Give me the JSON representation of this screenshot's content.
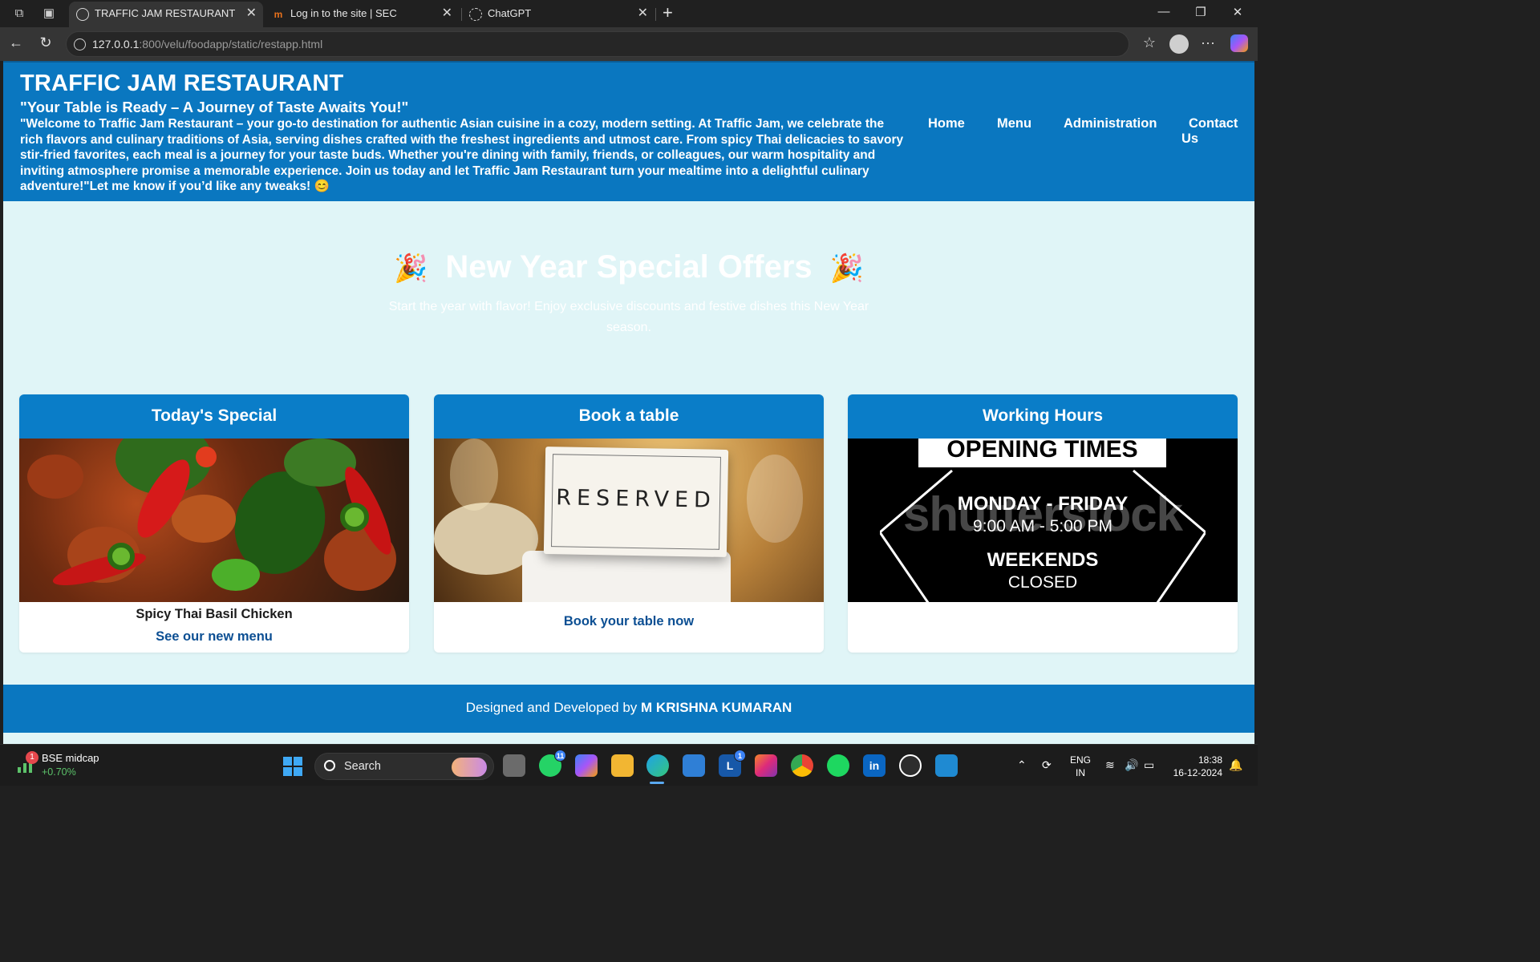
{
  "browser": {
    "tabs": [
      {
        "label": "TRAFFIC JAM RESTAURANT",
        "active": true
      },
      {
        "label": "Log in to the site | SEC",
        "active": false
      },
      {
        "label": "ChatGPT",
        "active": false
      }
    ],
    "address": {
      "host": "127.0.0.1",
      "rest": ":800/velu/foodapp/static/restapp.html"
    }
  },
  "header": {
    "title": "TRAFFIC JAM RESTAURANT",
    "tagline": "\"Your Table is Ready – A Journey of Taste Awaits You!\"",
    "intro": "\"Welcome to Traffic Jam Restaurant – your go-to destination for authentic Asian cuisine in a cozy, modern setting. At Traffic Jam, we celebrate the rich flavors and culinary traditions of Asia, serving dishes crafted with the freshest ingredients and utmost care. From spicy Thai delicacies to savory stir-fried favorites, each meal is a journey for your taste buds. Whether you're dining with family, friends, or colleagues, our warm hospitality and inviting atmosphere promise a memorable experience. Join us today and let Traffic Jam Restaurant turn your mealtime into a delightful culinary adventure!\"Let me know if you’d like any tweaks! 😊",
    "nav": [
      {
        "label": "Home"
      },
      {
        "label": "Menu"
      },
      {
        "label": "Administration"
      },
      {
        "label": "Contact Us"
      }
    ]
  },
  "hero": {
    "icon": "🎉",
    "title": "New Year Special Offers",
    "subtitle": "Start the year with flavor! Enjoy exclusive discounts and festive dishes this New Year season."
  },
  "cards": [
    {
      "title": "Today's Special",
      "caption": "Spicy Thai Basil Chicken",
      "link": "See our new menu",
      "image": "spicy-thai-basil-chicken-photo"
    },
    {
      "title": "Book a table",
      "link": "Book your table now",
      "image": "reserved-table-photo",
      "image_text": "RESERVED"
    },
    {
      "title": "Working Hours",
      "image": "opening-times-sign",
      "image_text": {
        "banner": "OPENING TIMES",
        "weekday_label": "MONDAY - FRIDAY",
        "weekday_hours": "9:00 AM - 5:00 PM",
        "weekend_label": "WEEKENDS",
        "weekend_status": "CLOSED",
        "watermark": "shutterstock"
      }
    }
  ],
  "footer": {
    "prefix": "Designed and Developed by",
    "author": "M KRISHNA KUMARAN"
  },
  "taskbar": {
    "widget_badge": "1",
    "widget_title": "BSE midcap",
    "widget_change": "+0.70%",
    "search_label": "Search",
    "whatsapp_badge": "11",
    "linkedin_learning_badge": "1",
    "language_line1": "ENG",
    "language_line2": "IN",
    "time": "18:38",
    "date": "16-12-2024"
  },
  "colors": {
    "header_blue": "#0a77c0",
    "page_bg": "#e0f5f7",
    "card_head": "#0a7dc8",
    "link_blue": "#0c4f93"
  }
}
